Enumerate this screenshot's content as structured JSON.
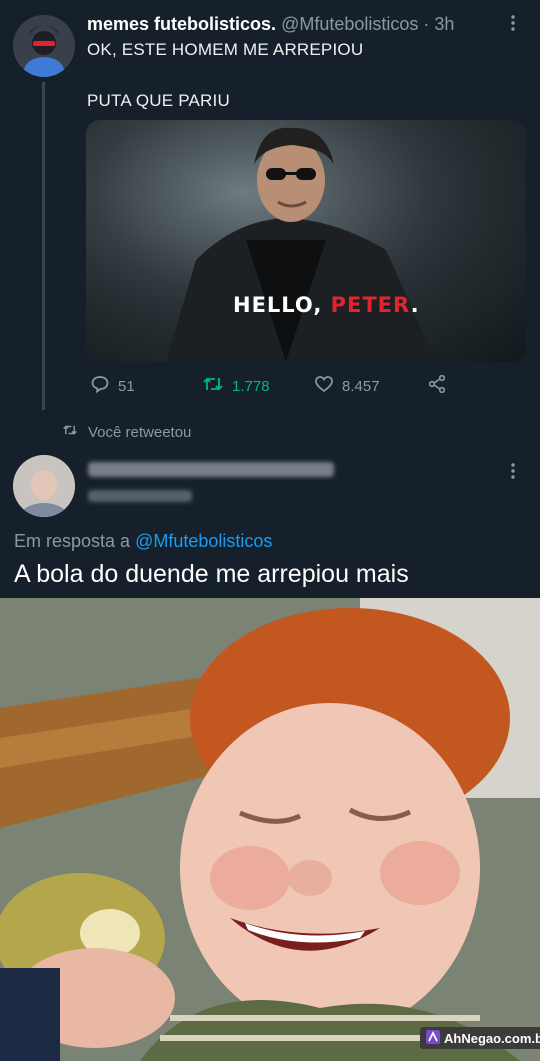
{
  "tweet": {
    "display_name": "memes futebolisticos.",
    "handle": "@Mfutebolisticos",
    "time": "· 3h",
    "text_line1": "OK, ESTE HOMEM ME ARREPIOU",
    "text_line2": "PUTA QUE PARIU",
    "media_caption_white": "HELLO, ",
    "media_caption_red": "PETER",
    "media_caption_dot": ".",
    "replies": "51",
    "retweets": "1.778",
    "likes": "8.457"
  },
  "retweet_notice": "Você retweetou",
  "reply": {
    "reply_prefix": "Em resposta a ",
    "reply_to_handle": "@Mfutebolisticos",
    "text": "A bola do duende me arrepiou mais"
  },
  "watermark": "AhNegao.com.br",
  "colors": {
    "background": "#15202b",
    "muted": "#8b98a5",
    "retweet_green": "#00ba7c",
    "link_blue": "#1d9bf0",
    "caption_red": "#e0252d"
  },
  "icons": {
    "reply": "reply-bubble-icon",
    "retweet": "retweet-arrows-icon",
    "like": "heart-icon",
    "share": "share-icon",
    "more": "more-vertical-icon"
  }
}
